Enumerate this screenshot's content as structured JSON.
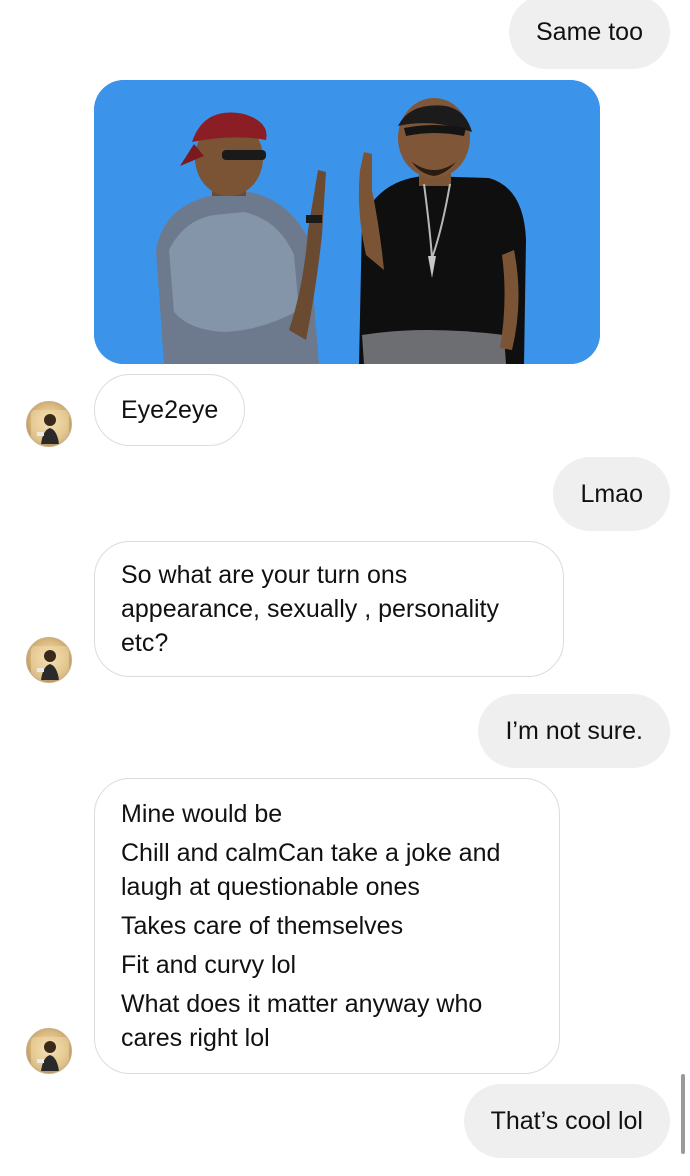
{
  "conversation": {
    "messages": [
      {
        "id": "m1",
        "direction": "outgoing",
        "lines": [
          "Same too"
        ]
      },
      {
        "id": "m2",
        "direction": "incoming",
        "type": "gif",
        "description": "two men pointing at their eyes"
      },
      {
        "id": "m3",
        "direction": "incoming",
        "lines": [
          "Eye2eye"
        ]
      },
      {
        "id": "m4",
        "direction": "outgoing",
        "lines": [
          "Lmao"
        ]
      },
      {
        "id": "m5",
        "direction": "incoming",
        "lines": [
          "So what are your turn ons",
          "appearance, sexually , personality",
          "etc?"
        ]
      },
      {
        "id": "m6",
        "direction": "outgoing",
        "lines": [
          "I’m not sure."
        ]
      },
      {
        "id": "m7",
        "direction": "incoming",
        "lines": [
          "Mine would be",
          "Chill and calmCan take a joke and",
          "laugh at questionable ones",
          "Takes care of themselves",
          "Fit and curvy lol",
          "What does it matter anyway who",
          "cares right  lol"
        ]
      },
      {
        "id": "m8",
        "direction": "outgoing",
        "lines": [
          "That’s cool lol"
        ]
      }
    ]
  },
  "colors": {
    "outgoing_bubble": "#efefef",
    "incoming_border": "#dcdcdc",
    "gif_background": "#3c94ea"
  }
}
